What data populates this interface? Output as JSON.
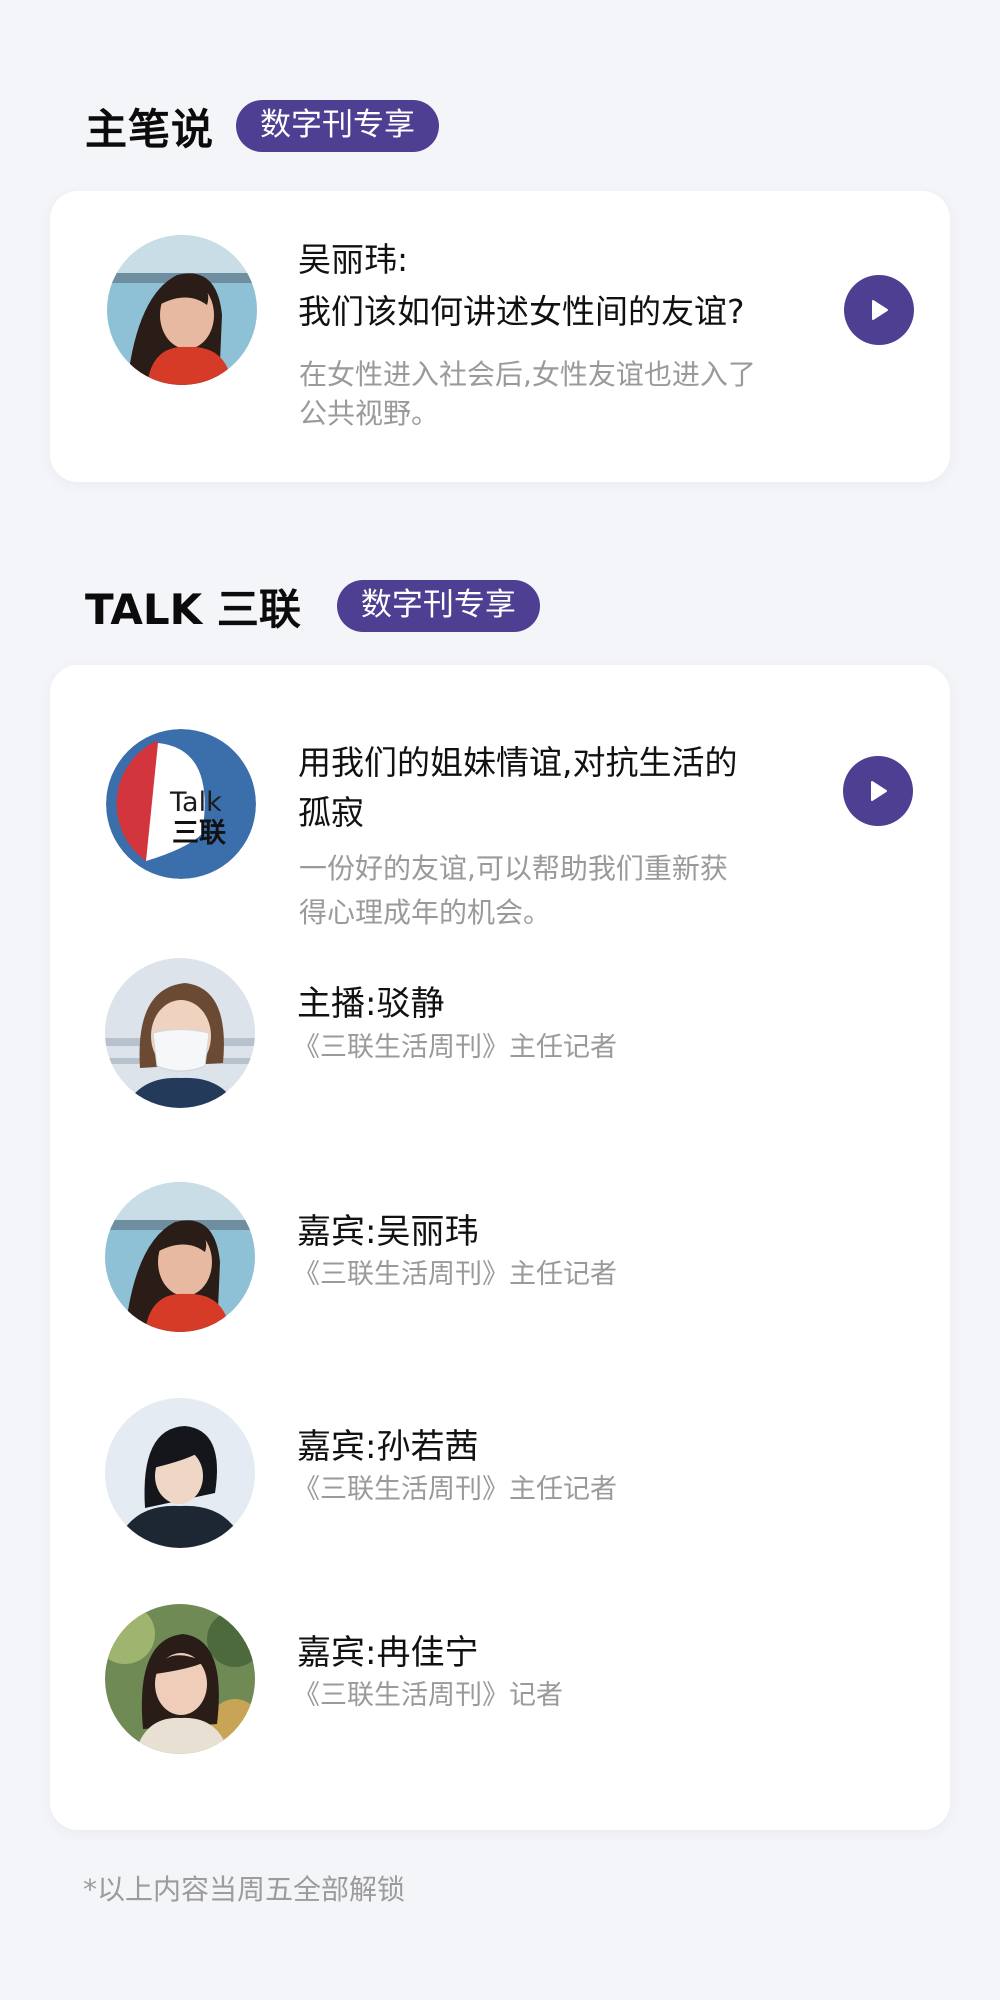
{
  "section1": {
    "title": "主笔说",
    "badge": "数字刊专享",
    "item": {
      "author": "吴丽玮:",
      "title": "我们该如何讲述女性间的友谊?",
      "desc_line1": "在女性进入社会后,女性友谊也进入了",
      "desc_line2": "公共视野。",
      "avatar_icon": "author-photo"
    }
  },
  "section2": {
    "title": "TALK 三联",
    "badge": "数字刊专享",
    "episode": {
      "title_line1": "用我们的姐妹情谊,对抗生活的",
      "title_line2": "孤寂",
      "desc_line1": "一份好的友谊,可以帮助我们重新获",
      "desc_line2": "得心理成年的机会。",
      "logo_text_top": "Talk",
      "logo_text_bottom": "三联"
    },
    "people": [
      {
        "name": "主播:驳静",
        "role": "《三联生活周刊》主任记者"
      },
      {
        "name": "嘉宾:吴丽玮",
        "role": "《三联生活周刊》主任记者"
      },
      {
        "name": "嘉宾:孙若茜",
        "role": "《三联生活周刊》主任记者"
      },
      {
        "name": "嘉宾:冉佳宁",
        "role": "《三联生活周刊》记者"
      }
    ]
  },
  "footnote": "*以上内容当周五全部解锁",
  "colors": {
    "accent": "#4f3f93",
    "background": "#f4f5f9",
    "muted_text": "#9a9a9a",
    "talk_logo_blue": "#3b6fac",
    "talk_logo_red": "#d2353b"
  }
}
